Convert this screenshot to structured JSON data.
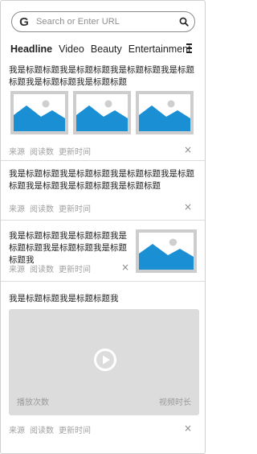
{
  "search": {
    "placeholder": "Search or Enter URL",
    "brand_letter": "G"
  },
  "tabs": [
    {
      "label": "Headline",
      "active": true
    },
    {
      "label": "Video",
      "active": false
    },
    {
      "label": "Beauty",
      "active": false
    },
    {
      "label": "Entertainment",
      "active": false
    }
  ],
  "colors": {
    "image_sky": "#1a8fd4",
    "image_frame": "#cdcdcd",
    "video_bg": "#dcdcdc"
  },
  "feed": [
    {
      "type": "three-images",
      "title": "我是标题标题我是标题标题我是标题标题我是标题标题我是标题标题我是标题标题",
      "meta": {
        "source": "来源",
        "reads": "阅读数",
        "updated": "更新时间"
      },
      "close": "×"
    },
    {
      "type": "text-only",
      "title": "我是标题标题我是标题标题我是标题标题我是标题标题我是标题我是标题标题我是标题标题",
      "meta": {
        "source": "来源",
        "reads": "阅读数",
        "updated": "更新时间"
      },
      "close": "×"
    },
    {
      "type": "right-image",
      "title": "我是标题标题我是标题标题我是标题标题我是标题标题我是标题标题我",
      "meta": {
        "source": "来源",
        "reads": "阅读数",
        "updated": "更新时间"
      },
      "close": "×"
    },
    {
      "type": "video",
      "title": "我是标题标题我是标题标题我",
      "video": {
        "plays": "播放次数",
        "duration": "视频时长"
      },
      "meta": {
        "source": "来源",
        "reads": "阅读数",
        "updated": "更新时间"
      },
      "close": "×"
    }
  ]
}
